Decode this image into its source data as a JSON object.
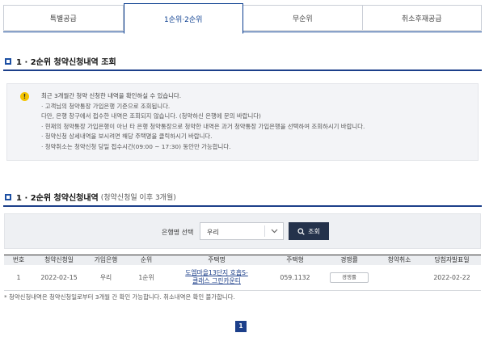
{
  "tabs": [
    "특별공급",
    "1순위·2순위",
    "무순위",
    "취소후재공급"
  ],
  "section1": {
    "title": "1 · 2순위 청약신청내역 조회"
  },
  "notice": {
    "icon": "warning-icon",
    "lines": [
      "최근 3개월간 청약 신청한 내역을 확인하실 수 있습니다.",
      "· 고객님의 청약통장 가입은행 기준으로 조회됩니다.",
      "  다만, 은행 창구에서 접수한 내역은 조회되지 않습니다. (청약하신 은행에 문의 바랍니다)",
      "· 현재의 청약통장 가입은행이 아닌 타 은행 청약통장으로 청약한 내역은 과거 청약통장 가입은행을 선택하여 조회하시기 바랍니다.",
      "· 청약신청 상세내역을 보시려면 해당 주택명을 클릭하시기 바랍니다.",
      "· 청약취소는 청약신청 당일 접수시간(09:00 ~ 17:30) 동안만 가능합니다."
    ]
  },
  "section2": {
    "title": "1 · 2순위 청약신청내역",
    "subtitle": "(청약신청일 이후 3개월)"
  },
  "filter": {
    "label": "은행명 선택",
    "selected": "우리",
    "search_button": "조회"
  },
  "table": {
    "headers": [
      "번호",
      "청약신청일",
      "가입은행",
      "순위",
      "주택명",
      "주택형",
      "경쟁률",
      "청약취소",
      "당첨자발표일"
    ],
    "rows": [
      {
        "no": "1",
        "date": "2022-02-15",
        "bank": "우리",
        "rank": "1순위",
        "house_l1": "도엠마을13단지 호흡S-",
        "house_l2": "클래스 그린카운티",
        "type": "059.1132",
        "comp": "경쟁률",
        "cancel": "",
        "announce": "2022-02-22"
      }
    ]
  },
  "footnote": "* 청약신청내역은 청약신청일로부터 3개월 간 확인 가능합니다. 취소내역은 확인 불가합니다.",
  "pagination": {
    "current": "1"
  },
  "colors": {
    "primary": "#1c3f8a",
    "warning": "#f4c400",
    "search_button": "#24324b"
  }
}
